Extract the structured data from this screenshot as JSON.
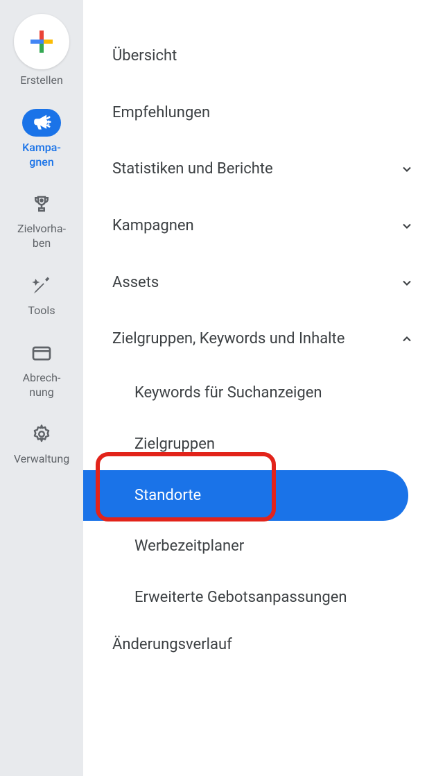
{
  "sidebar": {
    "items": [
      {
        "label": "Erstellen"
      },
      {
        "label": "Kampa-\ngnen"
      },
      {
        "label": "Zielvorha-\nben"
      },
      {
        "label": "Tools"
      },
      {
        "label": "Abrech-\nnung"
      },
      {
        "label": "Verwaltung"
      }
    ]
  },
  "menu": {
    "overview": "Übersicht",
    "recommendations": "Empfehlungen",
    "stats": "Statistiken und Berichte",
    "campaigns": "Kampagnen",
    "assets": "Assets",
    "audiences": "Zielgruppen, Keywords und Inhalte",
    "sub": {
      "keywords": "Keywords für Suchanzeigen",
      "audiences": "Zielgruppen",
      "locations": "Standorte",
      "scheduler": "Werbezeitplaner",
      "bids": "Erweiterte Gebotsanpassungen"
    },
    "history": "Änderungsverlauf"
  }
}
